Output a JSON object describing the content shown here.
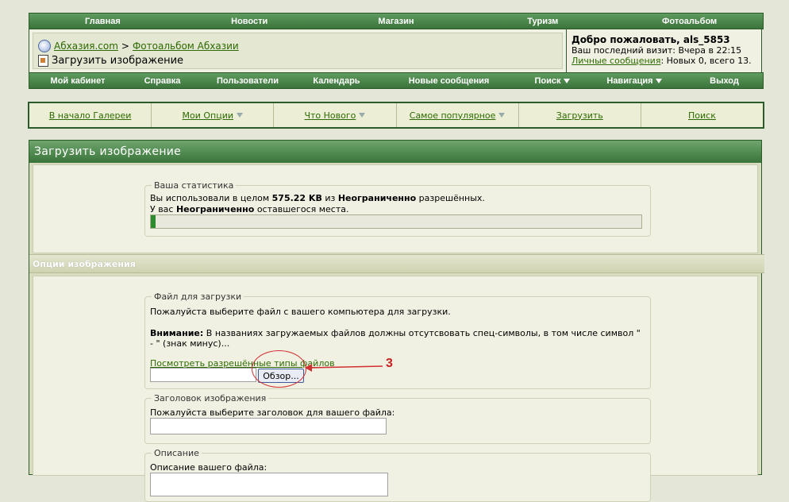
{
  "top_nav": [
    "Главная",
    "Новости",
    "Магазин",
    "Туризм",
    "Фотоальбом"
  ],
  "breadcrumb": {
    "site": "Абхазия.com",
    "separator": ">",
    "album": "Фотоальбом Абхазии",
    "page_title": "Загрузить изображение"
  },
  "welcome": {
    "title": "Добро пожаловать, als_5853",
    "last_visit": "Ваш последний визит: Вчера в 22:15",
    "pm_link": "Личные сообщения",
    "pm_counts": ": Новых 0, всего 13."
  },
  "user_nav": [
    {
      "label": "Мой кабинет",
      "dropdown": false
    },
    {
      "label": "Справка",
      "dropdown": false
    },
    {
      "label": "Пользователи",
      "dropdown": false
    },
    {
      "label": "Календарь",
      "dropdown": false
    },
    {
      "label": "Новые сообщения",
      "dropdown": false
    },
    {
      "label": "Поиск",
      "dropdown": true
    },
    {
      "label": "Навигация",
      "dropdown": true
    },
    {
      "label": "Выход",
      "dropdown": false
    }
  ],
  "gallery_nav": [
    {
      "label": "В начало Галереи",
      "dropdown": false
    },
    {
      "label": "Мои Опции",
      "dropdown": true
    },
    {
      "label": "Что Нового",
      "dropdown": true
    },
    {
      "label": "Самое популярное",
      "dropdown": true
    },
    {
      "label": "Загрузить",
      "dropdown": false
    },
    {
      "label": "Поиск",
      "dropdown": false
    }
  ],
  "panel": {
    "title": "Загрузить изображение",
    "stats": {
      "legend": "Ваша статистика",
      "line1_pre": "Вы использовали в целом ",
      "line1_used": "575.22 KB",
      "line1_mid": " из ",
      "line1_limit": "Неограниченно",
      "line1_post": " разрешённых.",
      "line2_pre": "У вас ",
      "line2_value": "Неограниченно",
      "line2_post": " оставшегося места."
    },
    "options_title": "Опции изображения",
    "file": {
      "legend": "Файл для загрузки",
      "instruction": "Пожалуйста выберите файл с вашего компьютера для загрузки.",
      "warning_label": "Внимание:",
      "warning_text": " В названиях загружаемых файлов должны отсутсвовать спец-символы, в том числе символ \"",
      "warning_text2": "- \" (знак минус)...",
      "allowed_link": "Посмотреть разрешённые типы файлов",
      "file_value": "",
      "browse_label": "Обзор..."
    },
    "title_field": {
      "legend": "Заголовок изображения",
      "instruction": "Пожалуйста выберите заголовок для вашего файла:",
      "value": ""
    },
    "description": {
      "legend": "Описание",
      "instruction": "Описание вашего файла:"
    }
  },
  "annotation": {
    "label": "3"
  },
  "colors": {
    "nav_green": "#3a743a",
    "link_green": "#2d6a00",
    "panel_bg": "#f1f1e3",
    "annotation_red": "#d23030"
  }
}
